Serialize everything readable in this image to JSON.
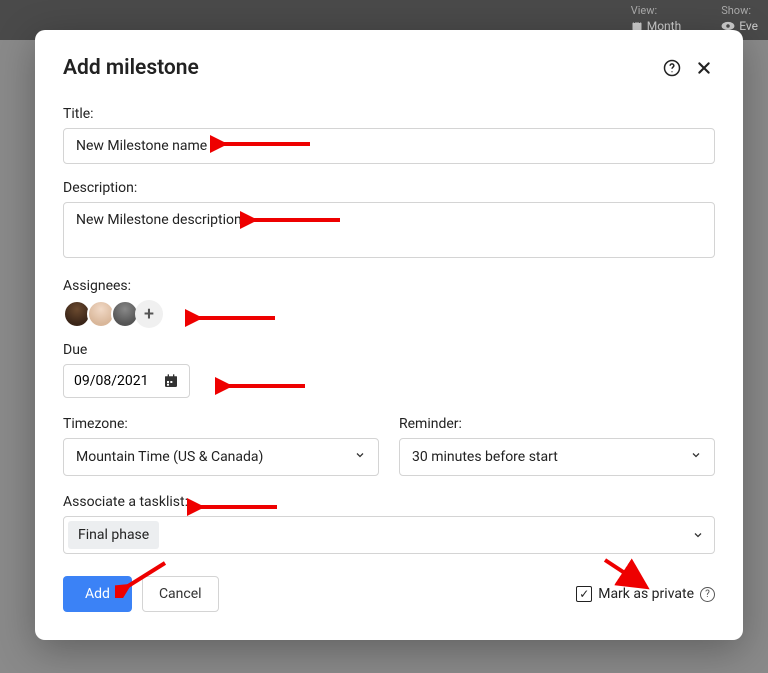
{
  "background": {
    "view_label": "View:",
    "view_value": "Month",
    "show_label": "Show:",
    "show_value": "Eve"
  },
  "modal": {
    "title": "Add milestone",
    "labels": {
      "title": "Title:",
      "description": "Description:",
      "assignees": "Assignees:",
      "due": "Due",
      "timezone": "Timezone:",
      "reminder": "Reminder:",
      "associate": "Associate a tasklist:"
    },
    "title_value": "New Milestone name",
    "description_value": "New Milestone description",
    "due_value": "09/08/2021",
    "timezone_value": "Mountain Time (US & Canada)",
    "reminder_value": "30 minutes before start",
    "tasklist_chip": "Final phase",
    "buttons": {
      "add": "Add",
      "cancel": "Cancel"
    },
    "private_label": "Mark as private",
    "private_checked": true
  }
}
